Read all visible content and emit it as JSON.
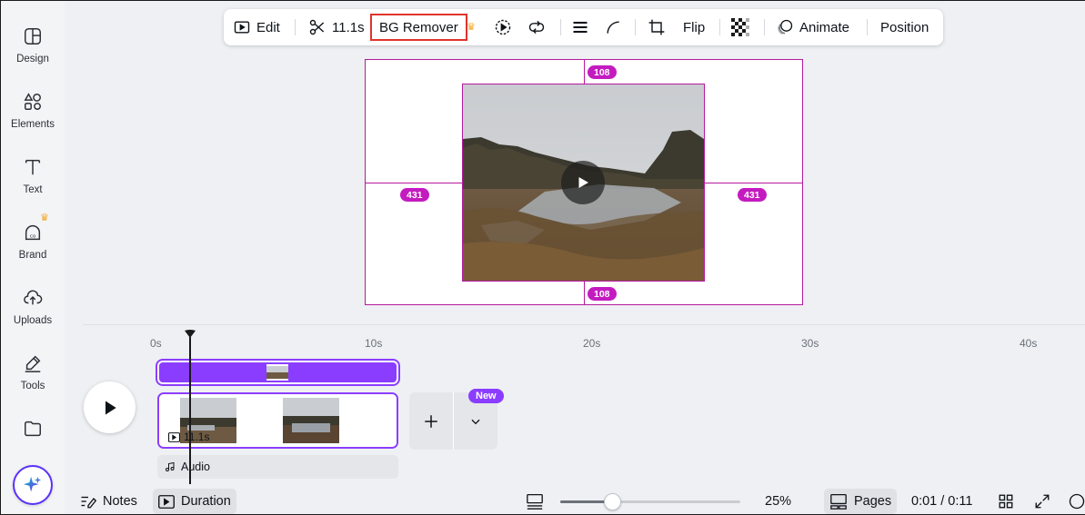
{
  "sidebar": {
    "items": [
      {
        "label": "Design",
        "icon": "design-icon"
      },
      {
        "label": "Elements",
        "icon": "elements-icon"
      },
      {
        "label": "Text",
        "icon": "text-icon"
      },
      {
        "label": "Brand",
        "icon": "brand-icon"
      },
      {
        "label": "Uploads",
        "icon": "uploads-icon"
      },
      {
        "label": "Tools",
        "icon": "tools-icon"
      },
      {
        "label": "",
        "icon": "projects-icon"
      }
    ],
    "magic_icon": "magic-sparkle-icon"
  },
  "toolbar": {
    "edit": "Edit",
    "trim": "11.1s",
    "bg_remover": "BG Remover",
    "flip": "Flip",
    "animate": "Animate",
    "position": "Position"
  },
  "canvas": {
    "top_gap": "108",
    "bottom_gap": "108",
    "left_gap": "431",
    "right_gap": "431",
    "guide_color": "#b5199f"
  },
  "timeline": {
    "ruler": [
      "0s",
      "10s",
      "20s",
      "30s",
      "40s"
    ],
    "clip_duration": "11.1s",
    "new_badge": "New",
    "audio": "Audio",
    "accent": "#8b3dff"
  },
  "footer": {
    "notes": "Notes",
    "duration": "Duration",
    "zoom": "25%",
    "zoom_level": 0.25,
    "pages": "Pages",
    "time": "0:01 / 0:11"
  }
}
